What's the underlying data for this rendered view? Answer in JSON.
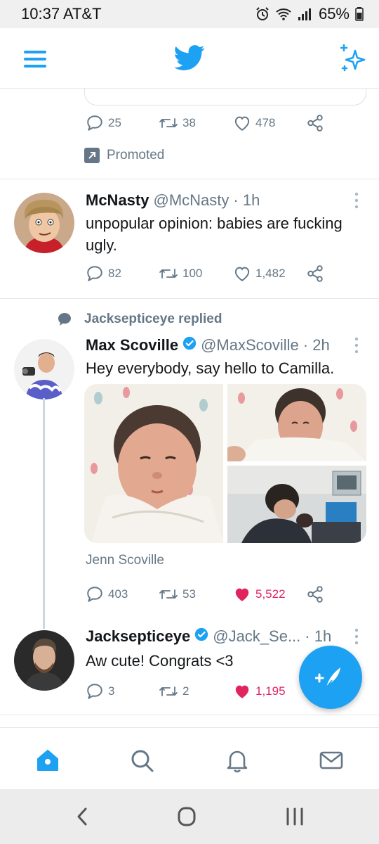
{
  "status_bar": {
    "time_carrier": "10:37 AT&T",
    "battery": "65%"
  },
  "colors": {
    "accent": "#1da1f2",
    "muted": "#657786",
    "like": "#e0245e",
    "text": "#14171a"
  },
  "promoted_tweet": {
    "replies": "25",
    "retweets": "38",
    "likes": "478",
    "promoted_label": "Promoted"
  },
  "tweets": [
    {
      "name": "McNasty",
      "handle": "@McNasty",
      "time": "· 1h",
      "text": "unpopular opinion: babies are fucking ugly.",
      "replies": "82",
      "retweets": "100",
      "likes": "1,482"
    },
    {
      "context": "Jacksepticeye replied",
      "name": "Max Scoville",
      "handle": "@MaxScoville",
      "time": "· 2h",
      "text": "Hey everybody, say hello to Camilla.",
      "tagged": "Jenn Scoville",
      "replies": "403",
      "retweets": "53",
      "likes": "5,522"
    },
    {
      "name": "Jacksepticeye",
      "handle": "@Jack_Se...",
      "time": "· 1h",
      "text": "Aw cute! Congrats <3",
      "replies": "3",
      "retweets": "2",
      "likes": "1,195"
    }
  ],
  "icons": {
    "menu": "hamburger-menu-icon",
    "logo": "twitter-bird-icon",
    "sparkle": "sparkle-icon",
    "compose": "compose-tweet-icon",
    "home": "home-icon",
    "search": "search-icon",
    "notifications": "bell-icon",
    "messages": "envelope-icon"
  }
}
